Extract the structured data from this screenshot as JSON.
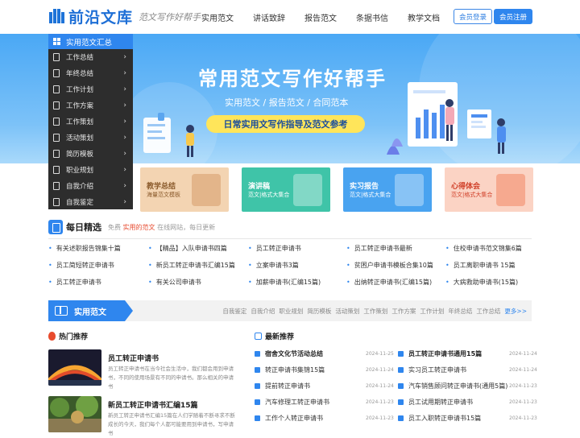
{
  "header": {
    "logo_text": "前沿文库",
    "slogan": "范文写作好帮手",
    "nav": [
      "实用范文",
      "讲话致辞",
      "报告范文",
      "条据书信",
      "教学文档"
    ],
    "login_label": "会员登录",
    "register_label": "会员注册"
  },
  "banner": {
    "title": "常用范文写作好帮手",
    "subtitle": "实用范文 / 报告范文 / 合同范本",
    "pill": "日常实用文写作指导及范文参考"
  },
  "sidebar": {
    "head": "实用范文汇总",
    "items": [
      "工作总结",
      "年终总结",
      "工作计划",
      "工作方案",
      "工作策划",
      "活动策划",
      "简历模板",
      "职业规划",
      "自我介绍",
      "自我鉴定"
    ]
  },
  "cards": [
    {
      "title": "教学总结",
      "sub": "海量范文模板",
      "color": "#f0cca7",
      "text_color": "#8a5a2b"
    },
    {
      "title": "演讲稿",
      "sub": "范文|格式大集合",
      "color": "#3fc4a8",
      "text_color": "#ffffff"
    },
    {
      "title": "实习报告",
      "sub": "范文|格式大集合",
      "color": "#49a3f0",
      "text_color": "#ffffff"
    },
    {
      "title": "心得体会",
      "sub": "范文|格式大集合",
      "color": "#f9c4b4",
      "text_color": "#d1412a"
    }
  ],
  "daily": {
    "title": "每日精选",
    "desc_pre": "免费",
    "desc_hl": "实用的范文",
    "desc_post": "在线网站，每日更新",
    "items": [
      "有关述职报告锦集十篇",
      "【精品】入队申请书四篇",
      "员工转正申请书",
      "员工转正申请书最新",
      "住校申请书范文锦集6篇",
      "员工简短转正申请书",
      "新员工转正申请书汇编15篇",
      "立案申请书3篇",
      "贫困户申请书模板合集10篇",
      "员工离职申请书 15篇",
      "员工转正申请书",
      "有关公司申请书",
      "加薪申请书(汇编15篇)",
      "出纳转正申请书(汇编15篇)",
      "大病救助申请书(15篇)"
    ]
  },
  "section": {
    "tab": "实用范文",
    "links": [
      "自我鉴定",
      "自我介绍",
      "职业规划",
      "简历模板",
      "活动策划",
      "工作策划",
      "工作方案",
      "工作计划",
      "年终总结",
      "工作总结"
    ],
    "more": "更多>>"
  },
  "hot": {
    "title": "热门推荐",
    "items": [
      {
        "title": "员工转正申请书",
        "desc": "员工转正申请书在当今社会生活中，我们都会用到申请书，不同的使用场景有不同的申请书。那么相关的申请书"
      },
      {
        "title": "新员工转正申请书汇编15篇",
        "desc": "新员工转正申请书汇编15篇在人们学随着不断寻求不断成长的今天，我们每个人都可能要用到申请书，写申请书"
      }
    ]
  },
  "newest": {
    "title": "最新推荐",
    "left": [
      {
        "title": "宿舍文化节活动总结",
        "date": "2024-11-25",
        "bold": true
      },
      {
        "title": "转正申请书集锦15篇",
        "date": "2024-11-24",
        "bold": false
      },
      {
        "title": "提前转正申请书",
        "date": "2024-11-24",
        "bold": false
      },
      {
        "title": "汽车修理工转正申请书",
        "date": "2024-11-23",
        "bold": false
      },
      {
        "title": "工作个人转正申请书",
        "date": "2024-11-23",
        "bold": false
      }
    ],
    "right": [
      {
        "title": "员工转正申请书通用15篇",
        "date": "2024-11-24",
        "bold": true
      },
      {
        "title": "实习员工转正申请书",
        "date": "2024-11-24",
        "bold": false
      },
      {
        "title": "汽车销售顾问转正申请书(通用5篇)",
        "date": "2024-11-23",
        "bold": false
      },
      {
        "title": "员工试用期转正申请书",
        "date": "2024-11-23",
        "bold": false
      },
      {
        "title": "员工入职转正申请书15篇",
        "date": "2024-11-23",
        "bold": false
      }
    ]
  }
}
